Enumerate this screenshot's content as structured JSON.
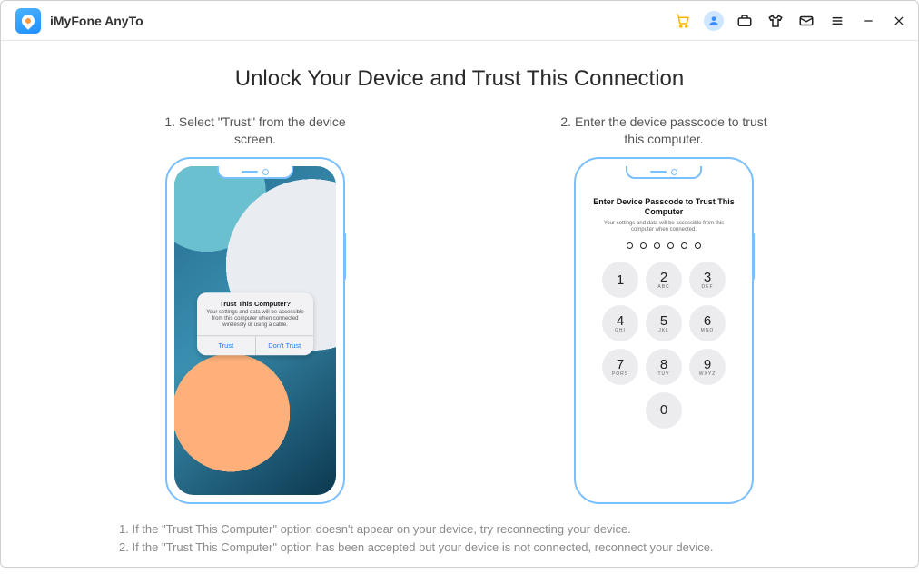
{
  "app_title": "iMyFone AnyTo",
  "titlebar_icons": {
    "cart": "cart-icon",
    "user": "user-icon",
    "case": "briefcase-icon",
    "shirt": "tshirt-icon",
    "mail": "mail-icon",
    "menu": "menu-icon",
    "minimize": "minimize-icon",
    "close": "close-icon"
  },
  "headline": "Unlock Your Device and Trust This Connection",
  "step1_caption": "1. Select \"Trust\" from the device screen.",
  "step2_caption": "2. Enter the device passcode to trust this computer.",
  "trust_popup": {
    "title": "Trust This Computer?",
    "body": "Your settings and data will be accessible from this computer when connected wirelessly or using a cable.",
    "btn_trust": "Trust",
    "btn_dont": "Don't Trust"
  },
  "passcode": {
    "title": "Enter Device Passcode to Trust This Computer",
    "sub": "Your settings and data will be accessible from this computer when connected.",
    "keys": [
      {
        "n": "1",
        "s": ""
      },
      {
        "n": "2",
        "s": "ABC"
      },
      {
        "n": "3",
        "s": "DEF"
      },
      {
        "n": "4",
        "s": "GHI"
      },
      {
        "n": "5",
        "s": "JKL"
      },
      {
        "n": "6",
        "s": "MNO"
      },
      {
        "n": "7",
        "s": "PQRS"
      },
      {
        "n": "8",
        "s": "TUV"
      },
      {
        "n": "9",
        "s": "WXYZ"
      },
      {
        "n": "0",
        "s": ""
      }
    ]
  },
  "notes": {
    "n1": "1. If the \"Trust This Computer\" option doesn't appear on your device, try reconnecting your device.",
    "n2": "2. If the \"Trust This Computer\" option has been accepted but your device is not connected, reconnect your device."
  }
}
